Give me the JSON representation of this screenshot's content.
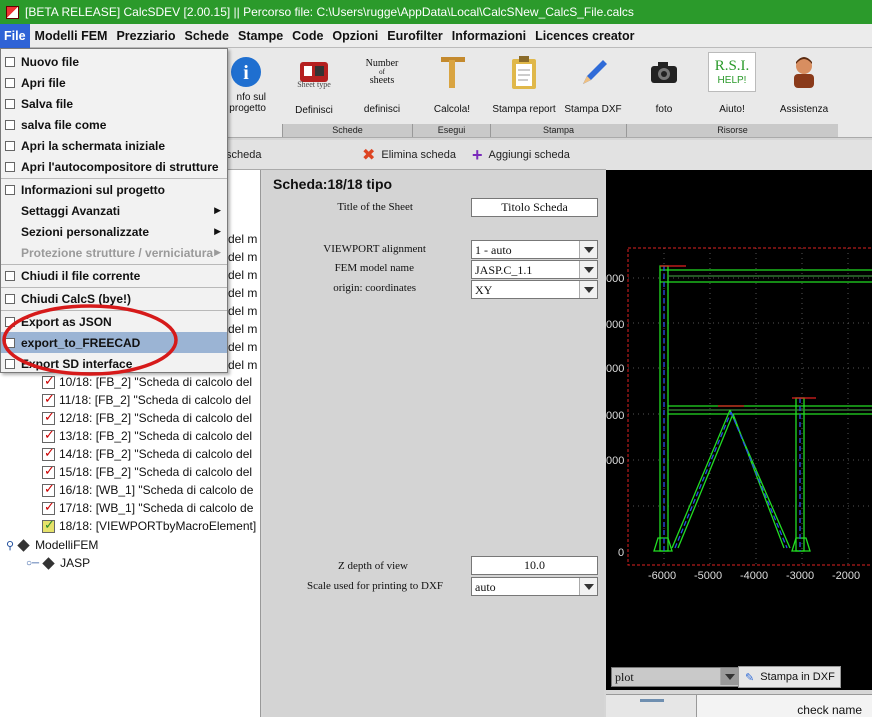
{
  "window": {
    "title": "[BETA RELEASE] CalcSDEV [2.00.15] || Percorso file: C:\\Users\\rugge\\AppData\\Local\\CalcSNew_CalcS_File.calcs"
  },
  "menubar": [
    "File",
    "Modelli FEM",
    "Prezziario",
    "Schede",
    "Stampe",
    "Code",
    "Opzioni",
    "Eurofilter",
    "Informazioni",
    "Licences creator"
  ],
  "file_menu": {
    "items": [
      "Nuovo file",
      "Apri file",
      "Salva file",
      "salva file come",
      "Apri la schermata iniziale",
      "Apri l'autocompositore di strutture",
      "Informazioni sul progetto",
      "Settaggi Avanzati",
      "Sezioni personalizzate",
      "Protezione strutture / verniciatura",
      "Chiudi il file corrente",
      "Chiudi CalcS (bye!)",
      "Export as JSON",
      "export_to_FREECAD",
      "Export SD interface"
    ]
  },
  "ribbon": {
    "partial_left": [
      "nfo sul",
      "progetto"
    ],
    "sheet_type_caption": "Sheet type",
    "number_of_sheets": {
      "top": "Number",
      "of": "of",
      "bottom": "sheets"
    },
    "tools": [
      "Definisci",
      "definisci",
      "Calcola!",
      "Stampa report",
      "Stampa DXF",
      "foto",
      "Aiuto!",
      "Assistenza"
    ],
    "rsi": {
      "top": "R.S.I.",
      "bottom": "HELP!"
    },
    "groups": [
      "Schede",
      "Esegui",
      "Stampa",
      "Risorse"
    ]
  },
  "subbar": {
    "partial_left": "scheda",
    "delete": "Elimina scheda",
    "add": "Aggiungi scheda"
  },
  "tree": {
    "partial_rows": [
      "del m",
      "del m",
      "del m",
      "del m",
      "del m",
      "del m",
      "del m",
      "del m"
    ],
    "rows": [
      "10/18: [FB_2] \"Scheda di calcolo del",
      "11/18: [FB_2] \"Scheda di calcolo del",
      "12/18: [FB_2] \"Scheda di calcolo del",
      "13/18: [FB_2] \"Scheda di calcolo del",
      "14/18: [FB_2] \"Scheda di calcolo del",
      "15/18: [FB_2] \"Scheda di calcolo del",
      "16/18: [WB_1] \"Scheda di calcolo de",
      "17/18: [WB_1] \"Scheda di calcolo de",
      "18/18: [VIEWPORTbyMacroElement]"
    ],
    "models_root": "ModelliFEM",
    "model": "JASP"
  },
  "props": {
    "heading": "Scheda:18/18 tipo",
    "title_label": "Title of the Sheet",
    "title_value": "Titolo Scheda",
    "viewport_label": "VIEWPORT alignment",
    "viewport_value": "1 - auto",
    "fem_label": "FEM model name",
    "fem_value": "JASP.C_1.1",
    "origin_label": "origin: coordinates",
    "origin_value": "XY",
    "zdepth_label": "Z depth of view",
    "zdepth_value": "10.0",
    "scale_label": "Scale used for printing to DXF",
    "scale_value": "auto"
  },
  "chart_data": {
    "type": "diagram",
    "x_tick_labels": [
      "-6000",
      "-5000",
      "-4000",
      "-3000",
      "-2000"
    ],
    "y_tick_labels": [
      "000",
      "000",
      "000",
      "000",
      "000",
      "0"
    ]
  },
  "plot": {
    "select_value": "plot",
    "print_button": "Stampa in DXF"
  },
  "bottom": {
    "check_name": "check name"
  },
  "colors": {
    "titlebar": "#2b9a2b",
    "menu_active": "#2f63d6",
    "hover": "#9bb4d4",
    "ellipse": "#d61a1a"
  }
}
